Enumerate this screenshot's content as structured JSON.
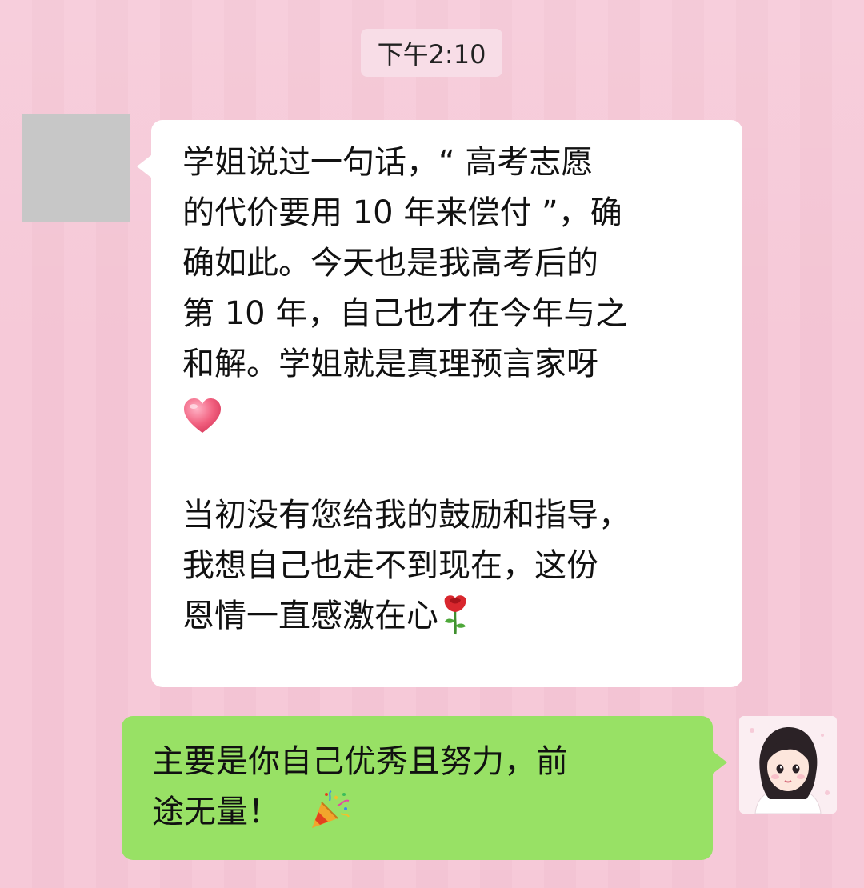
{
  "chat": {
    "timestamp": "下午2:10",
    "incoming": {
      "lines": [
        "学姐说过一句话，“ 高考志愿",
        "的代价要用 10 年来偿付 ”，确",
        "确如此。今天也是我高考后的",
        "第 10 年，自己也才在今年与之",
        "和解。学姐就是真理预言家呀",
        "当初没有您给我的鼓励和指导，",
        "我想自己也走不到现在，这份",
        "恩情一直感激在心"
      ],
      "emoji": [
        "heart-icon",
        "rose-icon"
      ]
    },
    "outgoing": {
      "lines": [
        "主要是你自己优秀且努力，前",
        "途无量！"
      ],
      "emoji": [
        "party-popper-icon"
      ]
    }
  },
  "colors": {
    "background": "#f6c6d6",
    "incoming_bubble": "#ffffff",
    "outgoing_bubble": "#98e165",
    "timestamp_bg": "#f8dde7"
  }
}
